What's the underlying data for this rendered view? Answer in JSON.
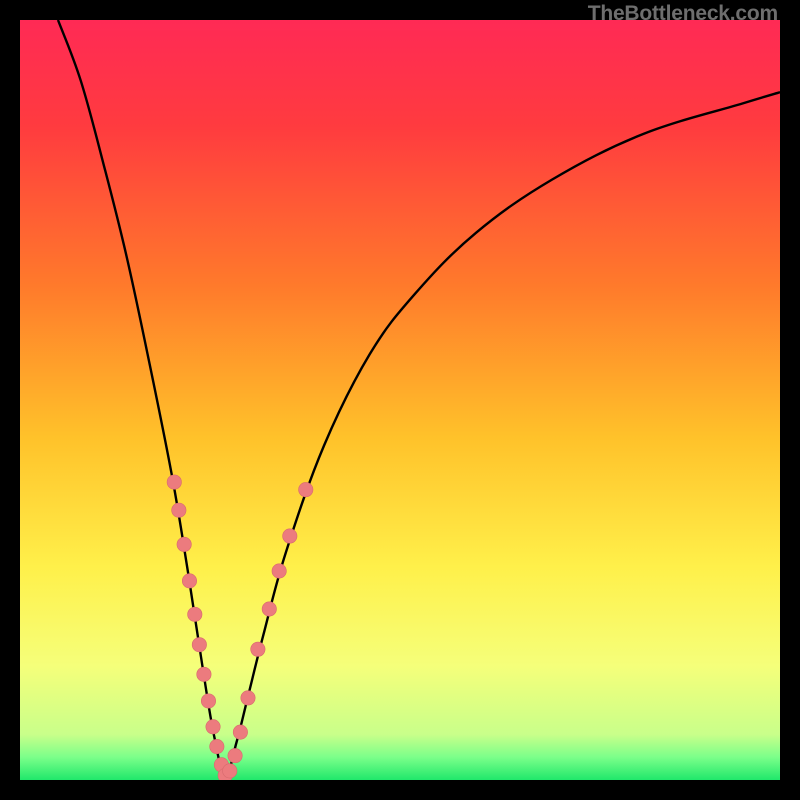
{
  "watermark": "TheBottleneck.com",
  "colors": {
    "gradient_stops": [
      {
        "offset": 0.0,
        "color": "#ff2a55"
      },
      {
        "offset": 0.14,
        "color": "#ff3b3f"
      },
      {
        "offset": 0.35,
        "color": "#ff7a2b"
      },
      {
        "offset": 0.55,
        "color": "#ffc22a"
      },
      {
        "offset": 0.72,
        "color": "#fff04a"
      },
      {
        "offset": 0.85,
        "color": "#f5ff7a"
      },
      {
        "offset": 0.94,
        "color": "#c9ff8a"
      },
      {
        "offset": 0.97,
        "color": "#7bff8a"
      },
      {
        "offset": 1.0,
        "color": "#20e86b"
      }
    ],
    "curve": "#000000",
    "marker_fill": "#ec7b7e",
    "marker_stroke": "#d86a6e",
    "background_frame": "#000000"
  },
  "chart_data": {
    "type": "line",
    "title": "",
    "xlabel": "",
    "ylabel": "",
    "xlim": [
      0,
      100
    ],
    "ylim": [
      0,
      100
    ],
    "grid": false,
    "legend": false,
    "curve_minimum_x": 27,
    "series": [
      {
        "name": "bottleneck-curve",
        "x": [
          5,
          8,
          11,
          14,
          17,
          20,
          22,
          24,
          25.5,
          27,
          28.5,
          30,
          32,
          35,
          40,
          46,
          52,
          60,
          70,
          82,
          95,
          100
        ],
        "y": [
          100,
          92,
          81,
          69,
          55,
          40,
          28,
          15,
          6,
          0.5,
          5,
          11,
          19,
          30,
          44,
          56,
          64,
          72,
          79,
          85,
          89,
          90.5
        ]
      }
    ],
    "markers": [
      {
        "x": 20.3,
        "y": 39.2
      },
      {
        "x": 20.9,
        "y": 35.5
      },
      {
        "x": 21.6,
        "y": 31.0
      },
      {
        "x": 22.3,
        "y": 26.2
      },
      {
        "x": 23.0,
        "y": 21.8
      },
      {
        "x": 23.6,
        "y": 17.8
      },
      {
        "x": 24.2,
        "y": 13.9
      },
      {
        "x": 24.8,
        "y": 10.4
      },
      {
        "x": 25.4,
        "y": 7.0
      },
      {
        "x": 25.9,
        "y": 4.4
      },
      {
        "x": 26.5,
        "y": 2.0
      },
      {
        "x": 27.0,
        "y": 0.6
      },
      {
        "x": 27.6,
        "y": 1.2
      },
      {
        "x": 28.3,
        "y": 3.2
      },
      {
        "x": 29.0,
        "y": 6.3
      },
      {
        "x": 30.0,
        "y": 10.8
      },
      {
        "x": 31.3,
        "y": 17.2
      },
      {
        "x": 32.8,
        "y": 22.5
      },
      {
        "x": 34.1,
        "y": 27.5
      },
      {
        "x": 35.5,
        "y": 32.1
      },
      {
        "x": 37.6,
        "y": 38.2
      }
    ]
  }
}
